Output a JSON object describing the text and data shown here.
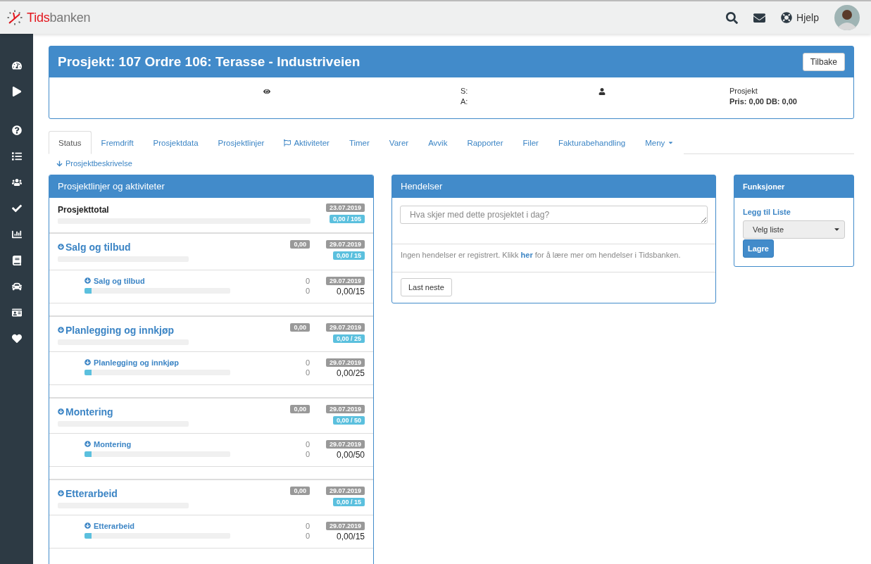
{
  "topbar": {
    "logo": [
      "Tids",
      "banken"
    ],
    "help": "Hjelp"
  },
  "header": {
    "title": "Prosjekt: 107 Ordre 106: Terasse - Industriveien",
    "back_button": "Tilbake",
    "s_label": "S:",
    "a_label": "A:",
    "type": "Prosjekt",
    "price": "Pris: 0,00 DB: 0,00"
  },
  "tabs": [
    {
      "label": "Status",
      "selected": true,
      "kind": "plain"
    },
    {
      "label": "Fremdrift",
      "selected": false,
      "kind": "plain"
    },
    {
      "label": "Prosjektdata",
      "selected": false,
      "kind": "plain"
    },
    {
      "label": "Prosjektlinjer",
      "selected": false,
      "kind": "plain"
    },
    {
      "label": "Aktiviteter",
      "selected": false,
      "kind": "flag"
    },
    {
      "label": "Timer",
      "selected": false,
      "kind": "plain"
    },
    {
      "label": "Varer",
      "selected": false,
      "kind": "plain"
    },
    {
      "label": "Avvik",
      "selected": false,
      "kind": "plain"
    },
    {
      "label": "Rapporter",
      "selected": false,
      "kind": "plain"
    },
    {
      "label": "Filer",
      "selected": false,
      "kind": "plain"
    },
    {
      "label": "Fakturabehandling",
      "selected": false,
      "kind": "plain"
    },
    {
      "label": "Meny",
      "selected": false,
      "kind": "dropdown"
    }
  ],
  "description_link": "Prosjektbeskrivelse",
  "lines_panel": {
    "title": "Prosjektlinjer og aktiviteter",
    "total": {
      "name": "Prosjekttotal",
      "date": "23.07.2019",
      "ratio": "0,00 / 105",
      "level": 0
    },
    "groups": [
      {
        "name": "Salg og tilbud",
        "amount": "0,00",
        "date": "29.07.2019",
        "ratio": "0,00 / 15",
        "level": 0,
        "children": [
          {
            "name": "Salg og tilbud",
            "count_1": "0",
            "count_2": "0",
            "date": "29.07.2019",
            "ratio": "0,00/15",
            "level": 0.05
          }
        ]
      },
      {
        "name": "Planlegging og innkjøp",
        "amount": "0,00",
        "date": "29.07.2019",
        "ratio": "0,00 / 25",
        "level": 0,
        "children": [
          {
            "name": "Planlegging og innkjøp",
            "count_1": "0",
            "count_2": "0",
            "date": "29.07.2019",
            "ratio": "0,00/25",
            "level": 0.05
          }
        ]
      },
      {
        "name": "Montering",
        "amount": "0,00",
        "date": "29.07.2019",
        "ratio": "0,00 / 50",
        "level": 0,
        "children": [
          {
            "name": "Montering",
            "count_1": "0",
            "count_2": "0",
            "date": "29.07.2019",
            "ratio": "0,00/50",
            "level": 0.05
          }
        ]
      },
      {
        "name": "Etterarbeid",
        "amount": "0,00",
        "date": "29.07.2019",
        "ratio": "0,00 / 15",
        "level": 0,
        "children": [
          {
            "name": "Etterarbeid",
            "count_1": "0",
            "count_2": "0",
            "date": "29.07.2019",
            "ratio": "0,00/15",
            "level": 0.05
          }
        ]
      }
    ]
  },
  "events": {
    "title": "Hendelser",
    "placeholder": "Hva skjer med dette prosjektet i dag?",
    "text_before": "Ingen hendelser er registrert. Klikk",
    "link": "her",
    "text_after": "for å lære mer om hendelser i Tidsbanken.",
    "more_button": "Last neste"
  },
  "functions": {
    "title": "Funksjoner",
    "add_label": "Legg til Liste",
    "select": "Velg liste",
    "save_button": "Lagre"
  }
}
